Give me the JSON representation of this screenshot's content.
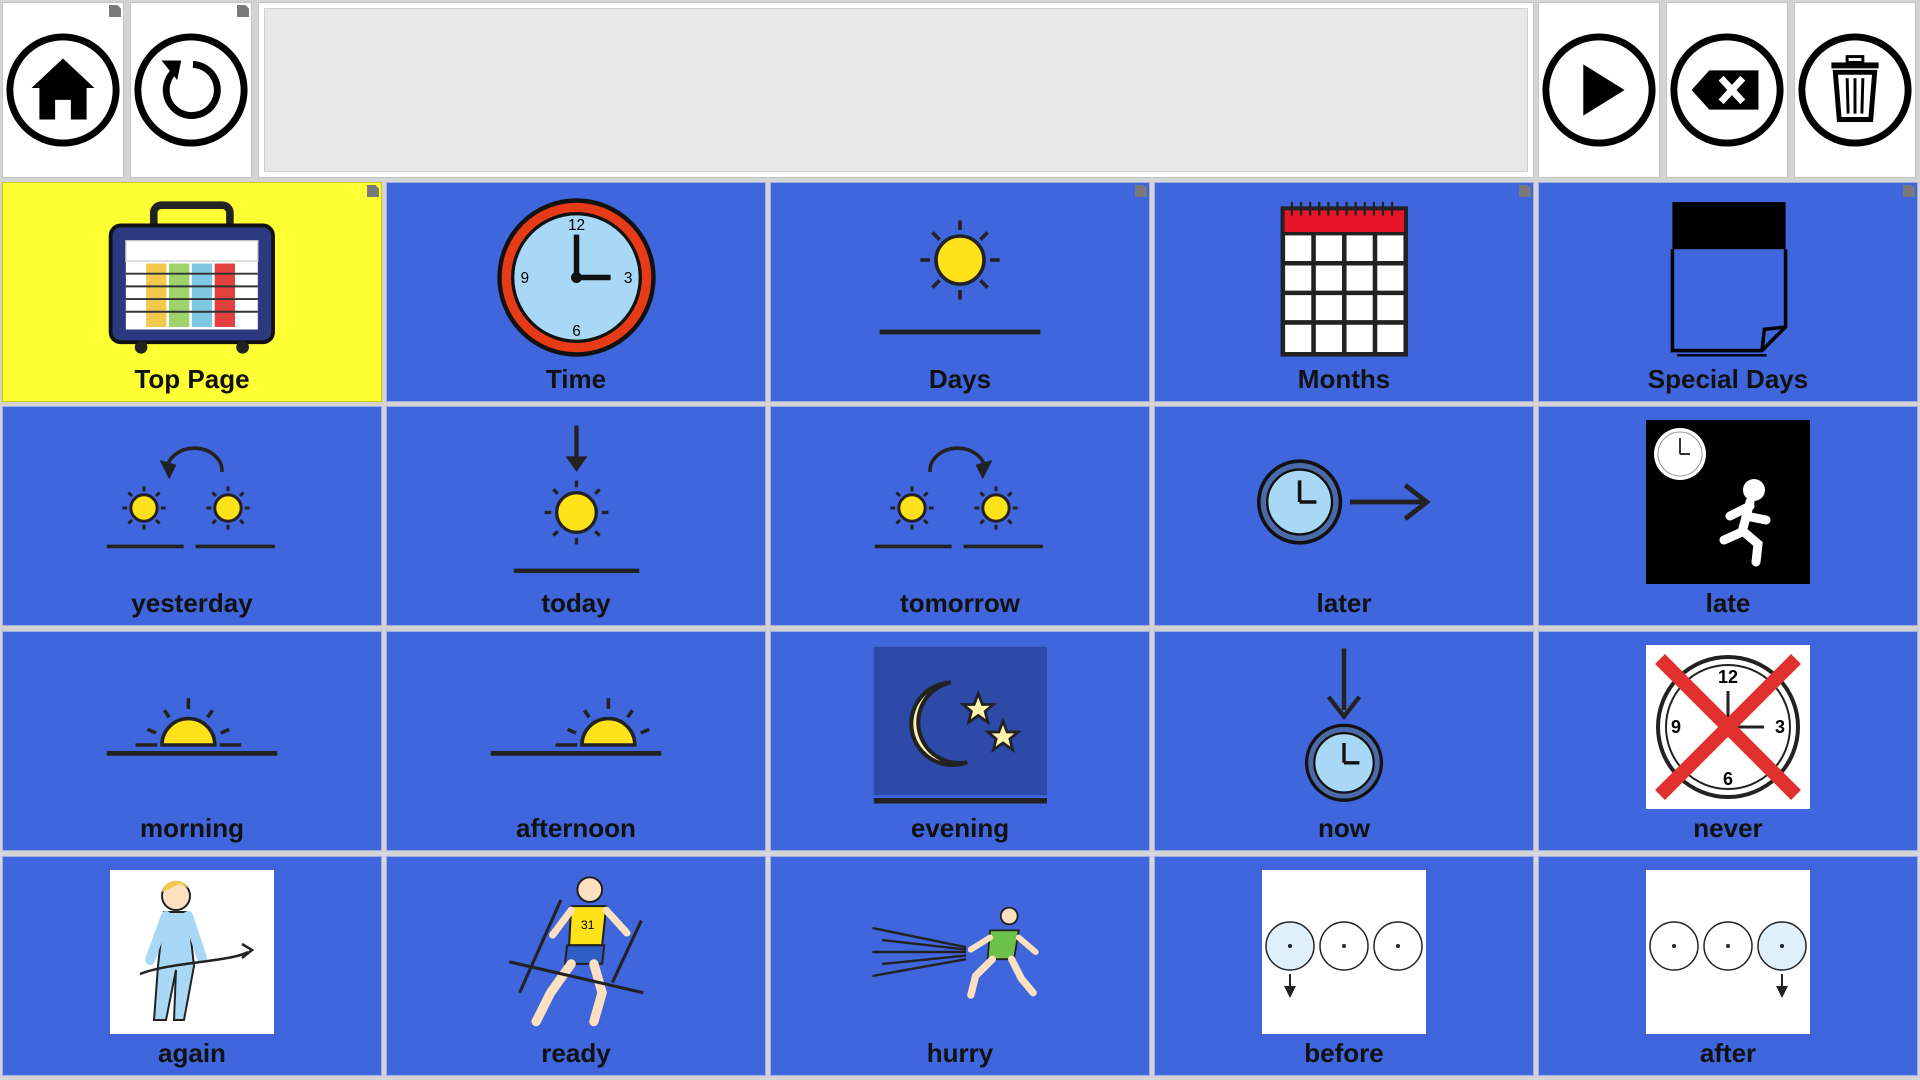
{
  "toolbar": {
    "left": [
      {
        "name": "home-button",
        "icon": "home-icon"
      },
      {
        "name": "back-button",
        "icon": "undo-icon"
      }
    ],
    "right": [
      {
        "name": "speak-button",
        "icon": "play-icon"
      },
      {
        "name": "backspace-button",
        "icon": "backspace-icon"
      },
      {
        "name": "clear-button",
        "icon": "trash-icon"
      }
    ]
  },
  "message_bar": {
    "text": ""
  },
  "colors": {
    "accent": "#3f66dc",
    "highlight": "#ffff33"
  },
  "grid": [
    {
      "label": "Top Page",
      "icon": "folder-tv-icon"
    },
    {
      "label": "Time",
      "icon": "clock-icon"
    },
    {
      "label": "Days",
      "icon": "sun-icon"
    },
    {
      "label": "Months",
      "icon": "calendar-icon"
    },
    {
      "label": "Special Days",
      "icon": "page-icon"
    },
    {
      "label": "yesterday",
      "icon": "yesterday-icon"
    },
    {
      "label": "today",
      "icon": "today-icon"
    },
    {
      "label": "tomorrow",
      "icon": "tomorrow-icon"
    },
    {
      "label": "later",
      "icon": "clock-arrow-icon"
    },
    {
      "label": "late",
      "icon": "running-late-icon"
    },
    {
      "label": "morning",
      "icon": "sunrise-icon"
    },
    {
      "label": "afternoon",
      "icon": "sunset-icon"
    },
    {
      "label": "evening",
      "icon": "moon-icon"
    },
    {
      "label": "now",
      "icon": "now-icon"
    },
    {
      "label": "never",
      "icon": "never-icon"
    },
    {
      "label": "again",
      "icon": "walk-around-icon"
    },
    {
      "label": "ready",
      "icon": "runner-icon"
    },
    {
      "label": "hurry",
      "icon": "hurry-icon"
    },
    {
      "label": "before",
      "icon": "clocks-before-icon"
    },
    {
      "label": "after",
      "icon": "clocks-after-icon"
    }
  ]
}
